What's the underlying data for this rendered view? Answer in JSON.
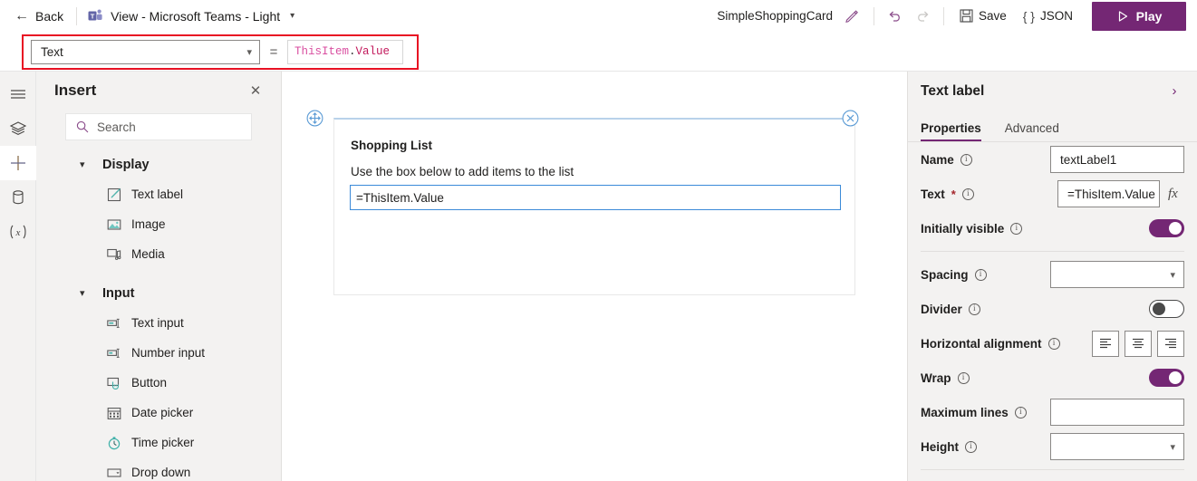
{
  "header": {
    "back_label": "Back",
    "back_icon": "arrow-left-icon",
    "view_icon": "microsoft-teams-icon",
    "view_label": "View - Microsoft Teams - Light",
    "view_chevron": "chevron-down-icon",
    "app_name": "SimpleShoppingCard",
    "edit_icon": "pencil-icon",
    "undo_icon": "undo-icon",
    "redo_icon": "redo-icon",
    "save_icon": "save-disk-icon",
    "save_label": "Save",
    "json_icon": "braces-icon",
    "json_label": "JSON",
    "play_icon": "play-triangle-icon",
    "play_label": "Play",
    "accent_color": "#742774"
  },
  "formula_bar": {
    "property_value": "Text",
    "property_chevron": "chevron-down-icon",
    "equals": "=",
    "formula_object": "ThisItem",
    "formula_dot": ".",
    "formula_property": "Value",
    "highlight_color": "#e81123"
  },
  "rail": {
    "items": [
      {
        "icon": "hamburger-menu-icon",
        "name": "menu"
      },
      {
        "icon": "layers-tree-view-icon",
        "name": "tree-view"
      },
      {
        "icon": "plus-insert-icon",
        "name": "insert"
      },
      {
        "icon": "database-cylinder-icon",
        "name": "data"
      },
      {
        "icon": "variables-x-icon",
        "name": "variables"
      }
    ],
    "active_index": 2
  },
  "insert_panel": {
    "title": "Insert",
    "close_icon": "close-icon",
    "search_icon": "search-icon",
    "search_placeholder": "Search",
    "search_value": "",
    "groups": [
      {
        "title": "Display",
        "chevron": "chevron-down-icon",
        "items": [
          {
            "label": "Text label",
            "icon": "text-label-icon"
          },
          {
            "label": "Image",
            "icon": "image-icon"
          },
          {
            "label": "Media",
            "icon": "media-icon"
          }
        ]
      },
      {
        "title": "Input",
        "chevron": "chevron-down-icon",
        "items": [
          {
            "label": "Text input",
            "icon": "text-input-icon"
          },
          {
            "label": "Number input",
            "icon": "number-input-icon"
          },
          {
            "label": "Button",
            "icon": "button-icon"
          },
          {
            "label": "Date picker",
            "icon": "calendar-icon"
          },
          {
            "label": "Time picker",
            "icon": "clock-icon"
          },
          {
            "label": "Drop down",
            "icon": "dropdown-icon"
          }
        ]
      }
    ]
  },
  "canvas": {
    "card_title": "Shopping List",
    "card_subtitle": "Use the box below to add items to the list",
    "card_input_value": "=ThisItem.Value",
    "move_handle_icon": "move-handle-icon",
    "delete_handle_icon": "delete-circle-icon"
  },
  "properties_panel": {
    "title": "Text label",
    "collapse_icon": "chevron-right-icon",
    "tabs": [
      {
        "label": "Properties",
        "active": true
      },
      {
        "label": "Advanced",
        "active": false
      }
    ],
    "rows": [
      {
        "label": "Name",
        "info_icon": "info-icon",
        "control": "text",
        "value": "textLabel1",
        "required": false
      },
      {
        "label": "Text",
        "info_icon": "info-icon",
        "control": "text_fx",
        "value": "=ThisItem.Value",
        "required": true,
        "fx_label": "fx"
      },
      {
        "label": "Initially visible",
        "info_icon": "info-icon",
        "control": "toggle",
        "value": "on"
      },
      {
        "label": "Spacing",
        "info_icon": "info-icon",
        "control": "select",
        "value": ""
      },
      {
        "label": "Divider",
        "info_icon": "info-icon",
        "control": "toggle",
        "value": "off"
      },
      {
        "label": "Horizontal alignment",
        "info_icon": "info-icon",
        "control": "align",
        "value": "none"
      },
      {
        "label": "Wrap",
        "info_icon": "info-icon",
        "control": "toggle",
        "value": "on"
      },
      {
        "label": "Maximum lines",
        "info_icon": "info-icon",
        "control": "text",
        "value": ""
      },
      {
        "label": "Height",
        "info_icon": "info-icon",
        "control": "select",
        "value": ""
      }
    ]
  }
}
